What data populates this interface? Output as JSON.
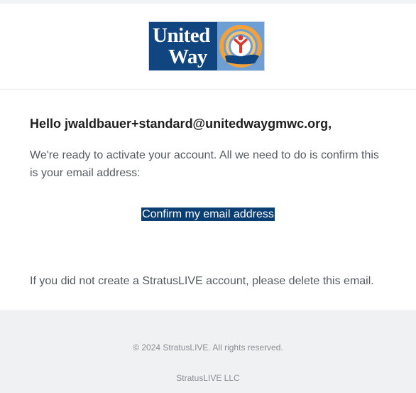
{
  "header": {
    "logo_line1": "United",
    "logo_line2": "Way"
  },
  "email": {
    "greeting": "Hello jwaldbauer+standard@unitedwaygmwc.org,",
    "body": "We're ready to activate your account. All we need to do is confirm this is your email address:",
    "cta_label": "Confirm my email address",
    "notice": "If you did not create a StratusLIVE account, please delete this email."
  },
  "footer": {
    "copyright": "© 2024 StratusLIVE. All rights reserved.",
    "company": "StratusLIVE LLC"
  },
  "colors": {
    "brand_blue": "#10457f",
    "logo_light_blue": "#6e9fd4",
    "logo_orange": "#f4a13a",
    "logo_red": "#e0362c",
    "button_bg": "#0b3f74",
    "footer_bg": "#f0f1f3"
  },
  "icons": {
    "logo_emblem": "united-way-hand-rainbow-person-icon"
  }
}
